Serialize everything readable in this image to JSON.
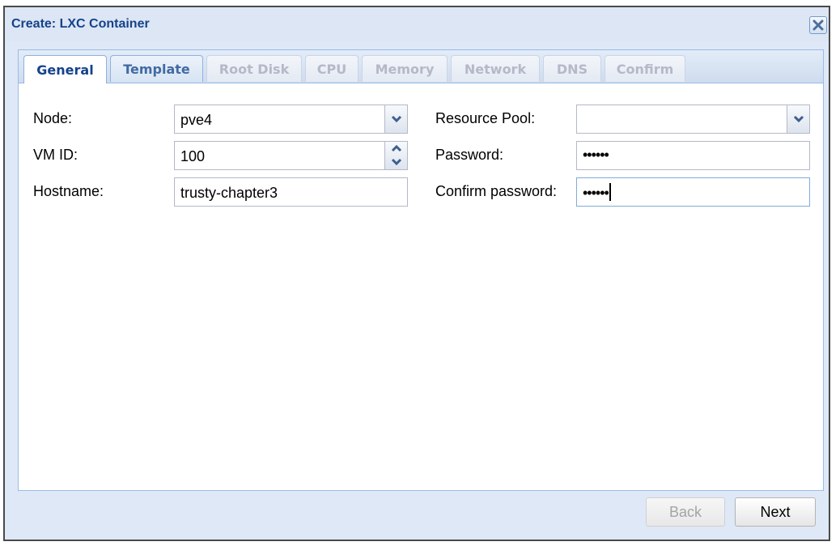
{
  "window": {
    "title": "Create: LXC Container"
  },
  "tabs": [
    {
      "label": "General",
      "state": "active"
    },
    {
      "label": "Template",
      "state": "enabled"
    },
    {
      "label": "Root Disk",
      "state": "disabled"
    },
    {
      "label": "CPU",
      "state": "disabled"
    },
    {
      "label": "Memory",
      "state": "disabled"
    },
    {
      "label": "Network",
      "state": "disabled"
    },
    {
      "label": "DNS",
      "state": "disabled"
    },
    {
      "label": "Confirm",
      "state": "disabled"
    }
  ],
  "form": {
    "node_label": "Node:",
    "node_value": "pve4",
    "vmid_label": "VM ID:",
    "vmid_value": "100",
    "hostname_label": "Hostname:",
    "hostname_value": "trusty-chapter3",
    "pool_label": "Resource Pool:",
    "pool_value": "",
    "password_label": "Password:",
    "password_mask": "••••••",
    "confirm_label": "Confirm password:",
    "confirm_mask": "••••••"
  },
  "footer": {
    "back_label": "Back",
    "next_label": "Next"
  },
  "colors": {
    "title": "#15428b",
    "accent_border": "#99bbe8",
    "window_bg": "#dfe8f6"
  }
}
